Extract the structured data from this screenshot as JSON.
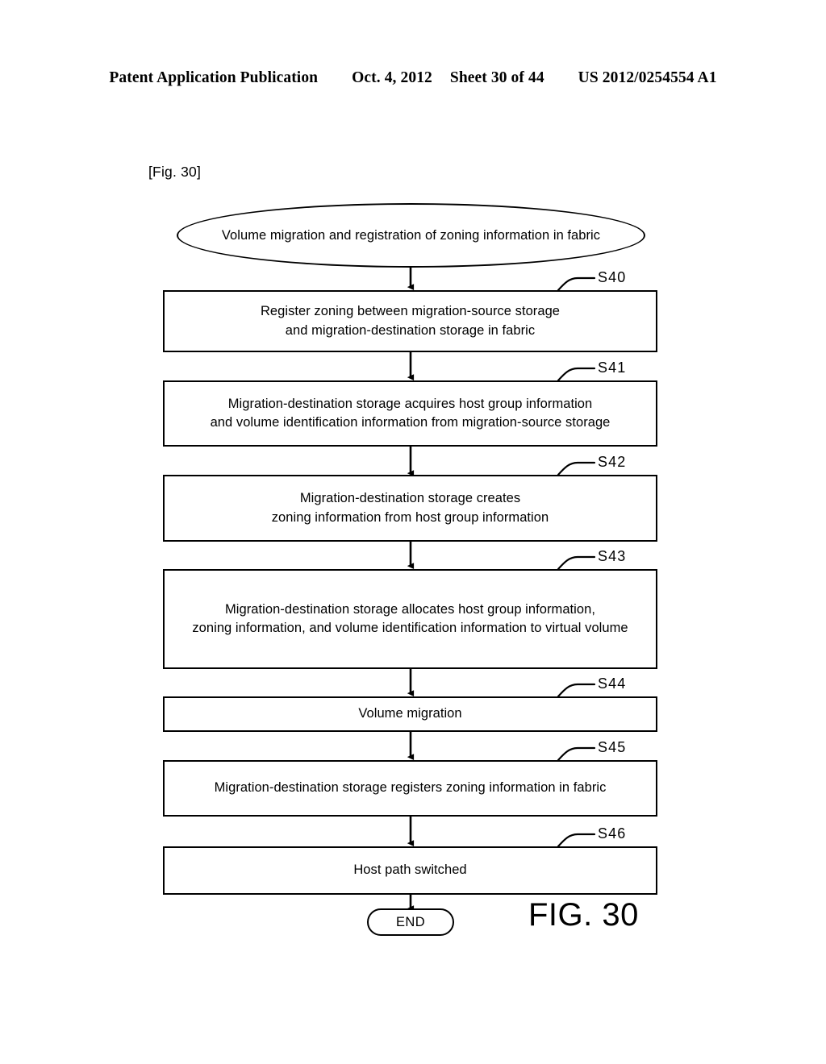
{
  "header": {
    "title": "Patent Application Publication",
    "date": "Oct. 4, 2012",
    "sheet": "Sheet 30 of 44",
    "publication_number": "US 2012/0254554 A1"
  },
  "figure": {
    "tag": "[Fig. 30]",
    "caption": "FIG. 30"
  },
  "flowchart": {
    "start": {
      "label": "Volume migration and registration of zoning information in fabric"
    },
    "end": {
      "label": "END"
    },
    "steps": [
      {
        "id": "S40",
        "lines": [
          "Register zoning between migration-source storage",
          "and migration-destination storage in fabric"
        ]
      },
      {
        "id": "S41",
        "lines": [
          "Migration-destination storage acquires host group information",
          "and volume identification information from migration-source storage"
        ]
      },
      {
        "id": "S42",
        "lines": [
          "Migration-destination storage creates",
          "zoning information from host group information"
        ]
      },
      {
        "id": "S43",
        "lines": [
          "Migration-destination storage allocates host group information,",
          "zoning information, and volume identification information to virtual volume"
        ]
      },
      {
        "id": "S44",
        "lines": [
          "Volume migration"
        ]
      },
      {
        "id": "S45",
        "lines": [
          "Migration-destination storage registers zoning information in fabric"
        ]
      },
      {
        "id": "S46",
        "lines": [
          "Host path switched"
        ]
      }
    ]
  },
  "colors": {
    "ink": "#000000",
    "paper": "#ffffff"
  }
}
